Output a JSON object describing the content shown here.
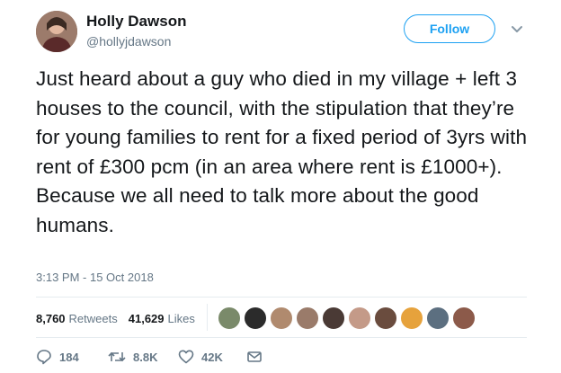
{
  "author": {
    "name": "Holly Dawson",
    "handle": "@hollyjdawson",
    "follow_label": "Follow"
  },
  "tweet": {
    "text": "Just heard about a guy who died in my village + left 3 houses to the council, with the stipulation that they’re for young families to rent for a fixed period of 3yrs with rent of £300 pcm (in an area where rent is £1000+). Because we all need to talk more about the good humans.",
    "timestamp": "3:13 PM - 15 Oct 2018"
  },
  "stats": {
    "retweets_count": "8,760",
    "retweets_label": "Retweets",
    "likes_count": "41,629",
    "likes_label": "Likes"
  },
  "likers": [
    {
      "color": "#7a8a6a"
    },
    {
      "color": "#2b2b2b"
    },
    {
      "color": "#b08a6e"
    },
    {
      "color": "#9a7b6a"
    },
    {
      "color": "#4a3a35"
    },
    {
      "color": "#c49a88"
    },
    {
      "color": "#6a4c3e"
    },
    {
      "color": "#e6a23c"
    },
    {
      "color": "#5c6f80"
    },
    {
      "color": "#8c5a4a"
    }
  ],
  "actions": {
    "replies": "184",
    "retweets": "8.8K",
    "likes": "42K"
  },
  "colors": {
    "accent": "#1da1f2",
    "muted": "#657786",
    "text": "#14171a"
  }
}
